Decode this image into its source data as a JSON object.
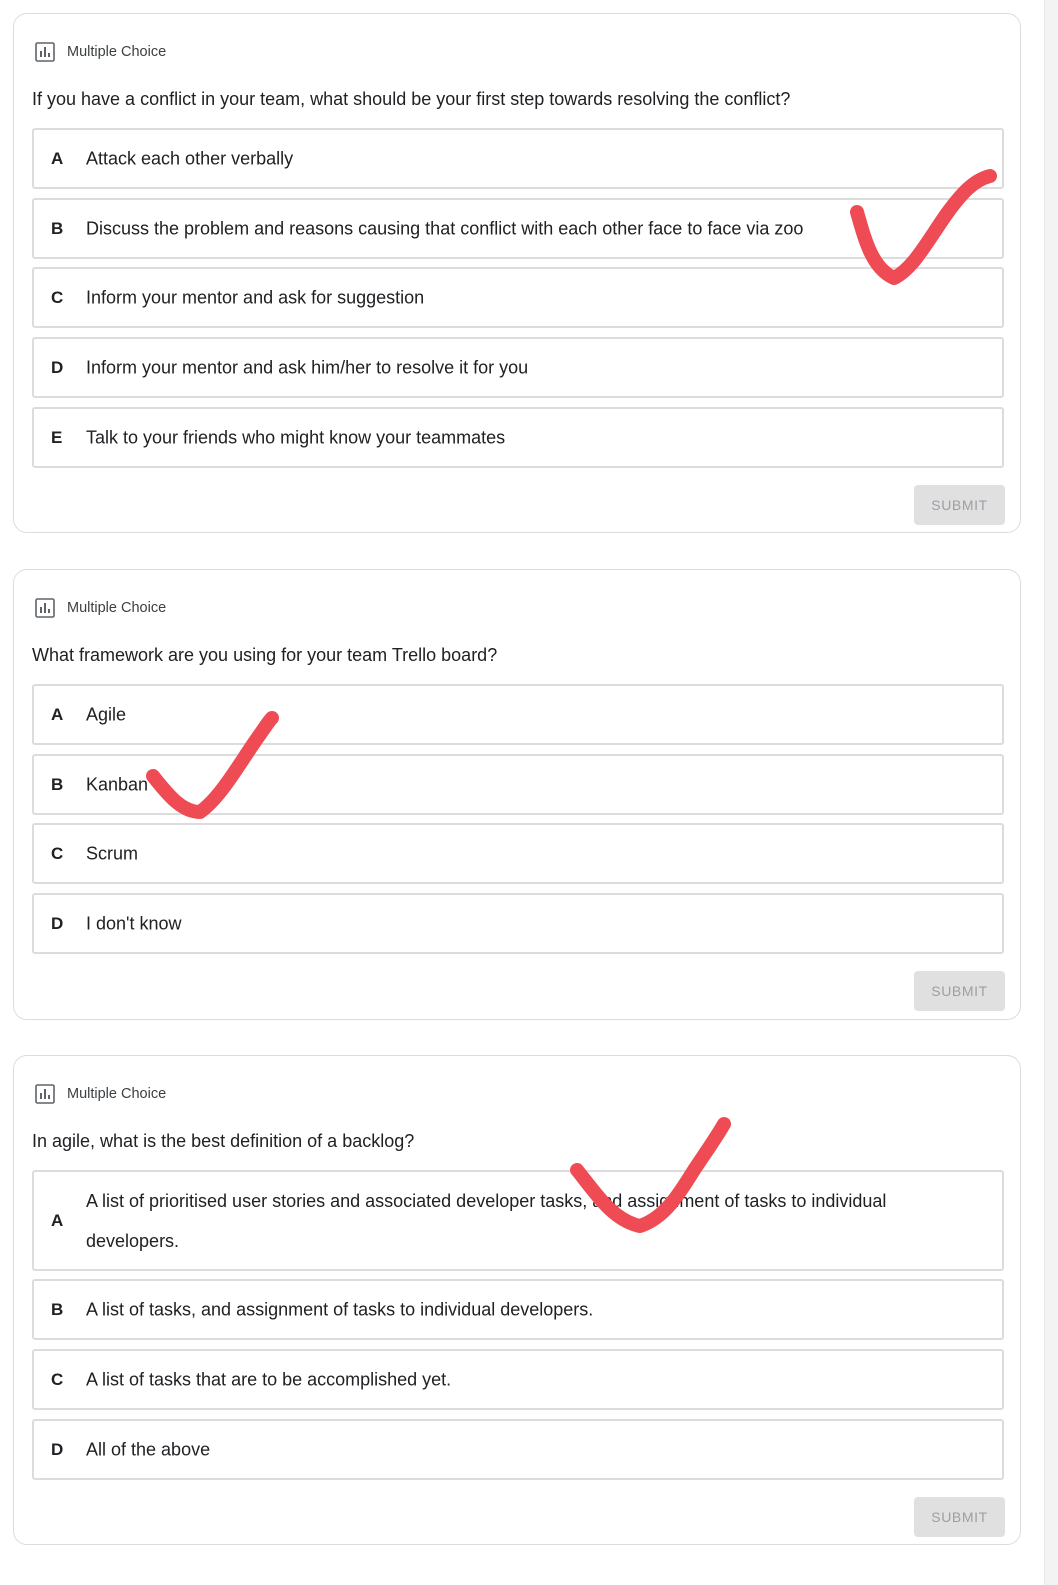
{
  "cards": [
    {
      "type_label": "Multiple Choice",
      "question": "If you have a conflict in your team, what should be your first step towards resolving the conflict?",
      "options": [
        {
          "letter": "A",
          "text": "Attack each other verbally"
        },
        {
          "letter": "B",
          "text": "Discuss the problem and reasons causing that conflict with each other face to face via zoo"
        },
        {
          "letter": "C",
          "text": "Inform your mentor and ask for suggestion"
        },
        {
          "letter": "D",
          "text": "Inform your mentor and ask him/her to resolve it for you"
        },
        {
          "letter": "E",
          "text": "Talk to your friends who might know your teammates"
        }
      ],
      "submit_label": "SUBMIT"
    },
    {
      "type_label": "Multiple Choice",
      "question": "What framework are you using for your team Trello board?",
      "options": [
        {
          "letter": "A",
          "text": "Agile"
        },
        {
          "letter": "B",
          "text": "Kanban"
        },
        {
          "letter": "C",
          "text": "Scrum"
        },
        {
          "letter": "D",
          "text": "I don't know"
        }
      ],
      "submit_label": "SUBMIT"
    },
    {
      "type_label": "Multiple Choice",
      "question": "In agile, what is the best definition of a backlog?",
      "options": [
        {
          "letter": "A",
          "text": "A list of prioritised user stories and associated developer tasks, and assignment of tasks to individual developers."
        },
        {
          "letter": "B",
          "text": "A list of tasks, and assignment of tasks to individual developers."
        },
        {
          "letter": "C",
          "text": "A list of tasks that are to be accomplished yet."
        },
        {
          "letter": "D",
          "text": "All of the above"
        }
      ],
      "submit_label": "SUBMIT"
    }
  ],
  "annotations": {
    "checkmark_color": "#ef4b54",
    "checked_options": [
      "card1-B",
      "card2-B",
      "card3-A"
    ]
  },
  "icons": {
    "card_type_icon": "poll-chart-icon",
    "answer_mark": "checkmark-icon"
  }
}
